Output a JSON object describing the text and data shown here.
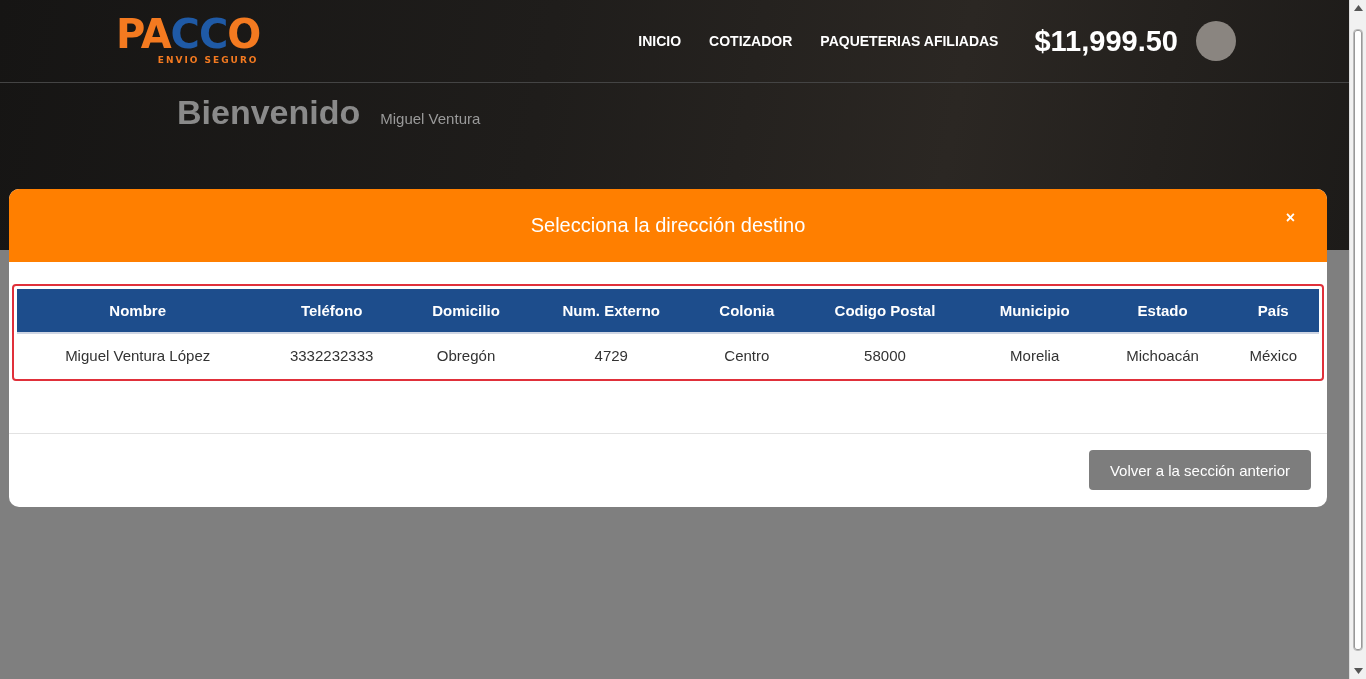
{
  "logo": {
    "parts": [
      {
        "text": "PA",
        "color": "#f47a20"
      },
      {
        "text": "CC",
        "color": "#1f5aa6"
      },
      {
        "text": "O",
        "color": "#f47a20"
      }
    ],
    "tagline": "ENVIO SEGURO"
  },
  "nav": {
    "items": [
      "INICIO",
      "COTIZADOR",
      "PAQUETERIAS AFILIADAS"
    ],
    "balance": "$11,999.50"
  },
  "welcome": {
    "title": "Bienvenido",
    "user": "Miguel Ventura"
  },
  "modal": {
    "title": "Selecciona la dirección destino",
    "close": "×",
    "table": {
      "columns": [
        "Nombre",
        "Teléfono",
        "Domicilio",
        "Num. Externo",
        "Colonia",
        "Codigo Postal",
        "Municipio",
        "Estado",
        "País"
      ],
      "rows": [
        [
          "Miguel Ventura López",
          "3332232333",
          "Obregón",
          "4729",
          "Centro",
          "58000",
          "Morelia",
          "Michoacán",
          "México"
        ]
      ]
    },
    "back_button": "Volver a la sección anterior"
  }
}
